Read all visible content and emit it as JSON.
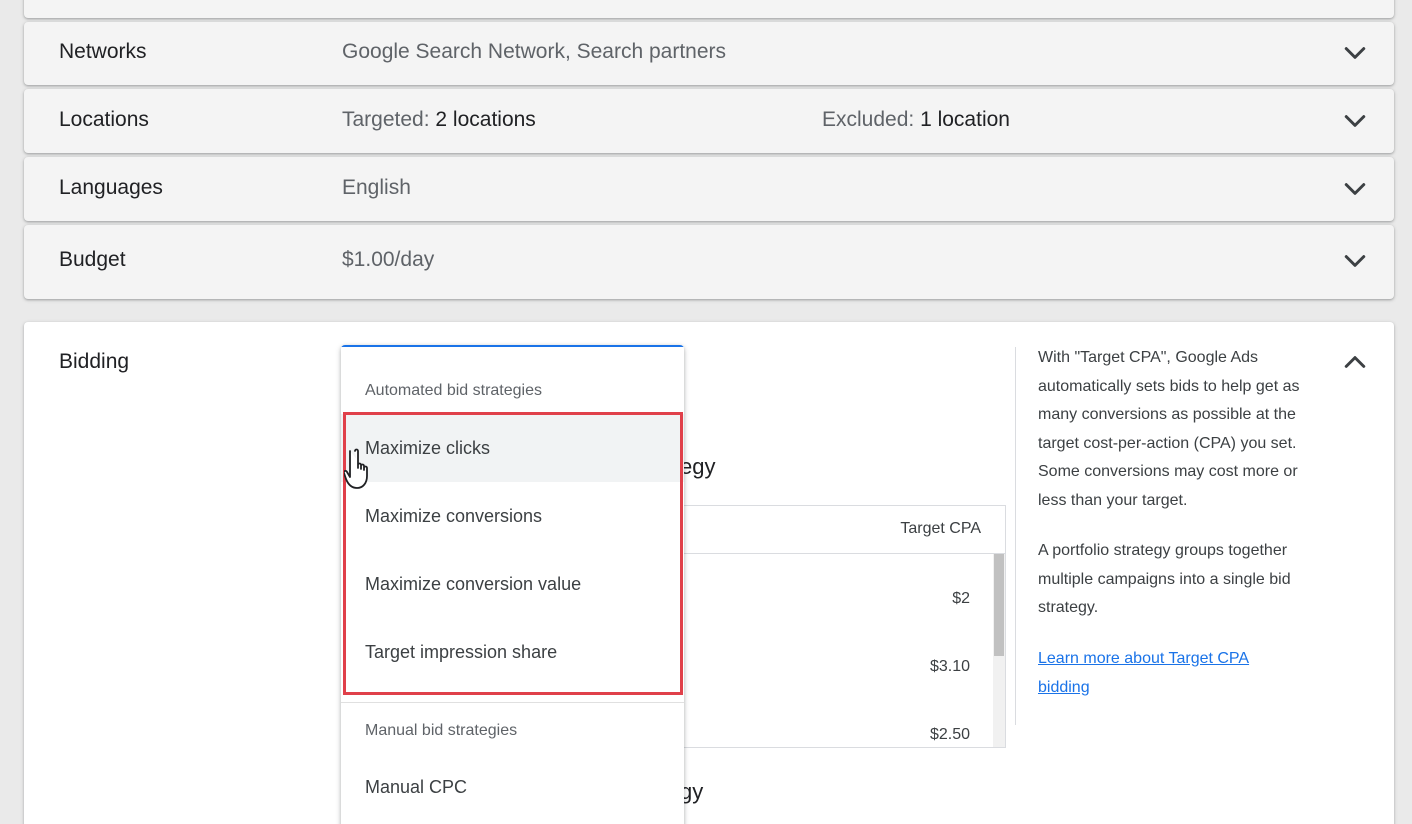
{
  "rows": [
    {
      "label": "Networks",
      "value": "Google Search Network, Search partners"
    },
    {
      "label": "Locations",
      "targeted_label": "Targeted:",
      "targeted_value": "2 locations",
      "excluded_label": "Excluded:",
      "excluded_value": "1 location"
    },
    {
      "label": "Languages",
      "value": "English"
    },
    {
      "label": "Budget",
      "value": "$1.00/day"
    }
  ],
  "bidding": {
    "label": "Bidding",
    "behind_text_1": "egy",
    "behind_text_2": "gy",
    "table": {
      "header": "Target CPA",
      "values": [
        "$2",
        "$3.10",
        "$2.50"
      ]
    },
    "help": {
      "para1": "With \"Target CPA\", Google Ads automatically sets bids to help get as many conversions as possible at the target cost-per-action (CPA) you set. Some conversions may cost more or less than your target.",
      "para2": "A portfolio strategy groups together multiple campaigns into a single bid strategy.",
      "link": "Learn more about Target CPA bidding"
    }
  },
  "dropdown": {
    "automated_header": "Automated bid strategies",
    "automated_items": [
      "Maximize clicks",
      "Maximize conversions",
      "Maximize conversion value",
      "Target impression share"
    ],
    "manual_header": "Manual bid strategies",
    "manual_items": [
      "Manual CPC"
    ]
  },
  "colors": {
    "accent": "#1a73e8",
    "highlight": "#e0404a"
  },
  "icons": {
    "collapsed": "chevron-down-icon",
    "expanded": "chevron-up-icon",
    "cursor": "hand-pointer-icon"
  }
}
